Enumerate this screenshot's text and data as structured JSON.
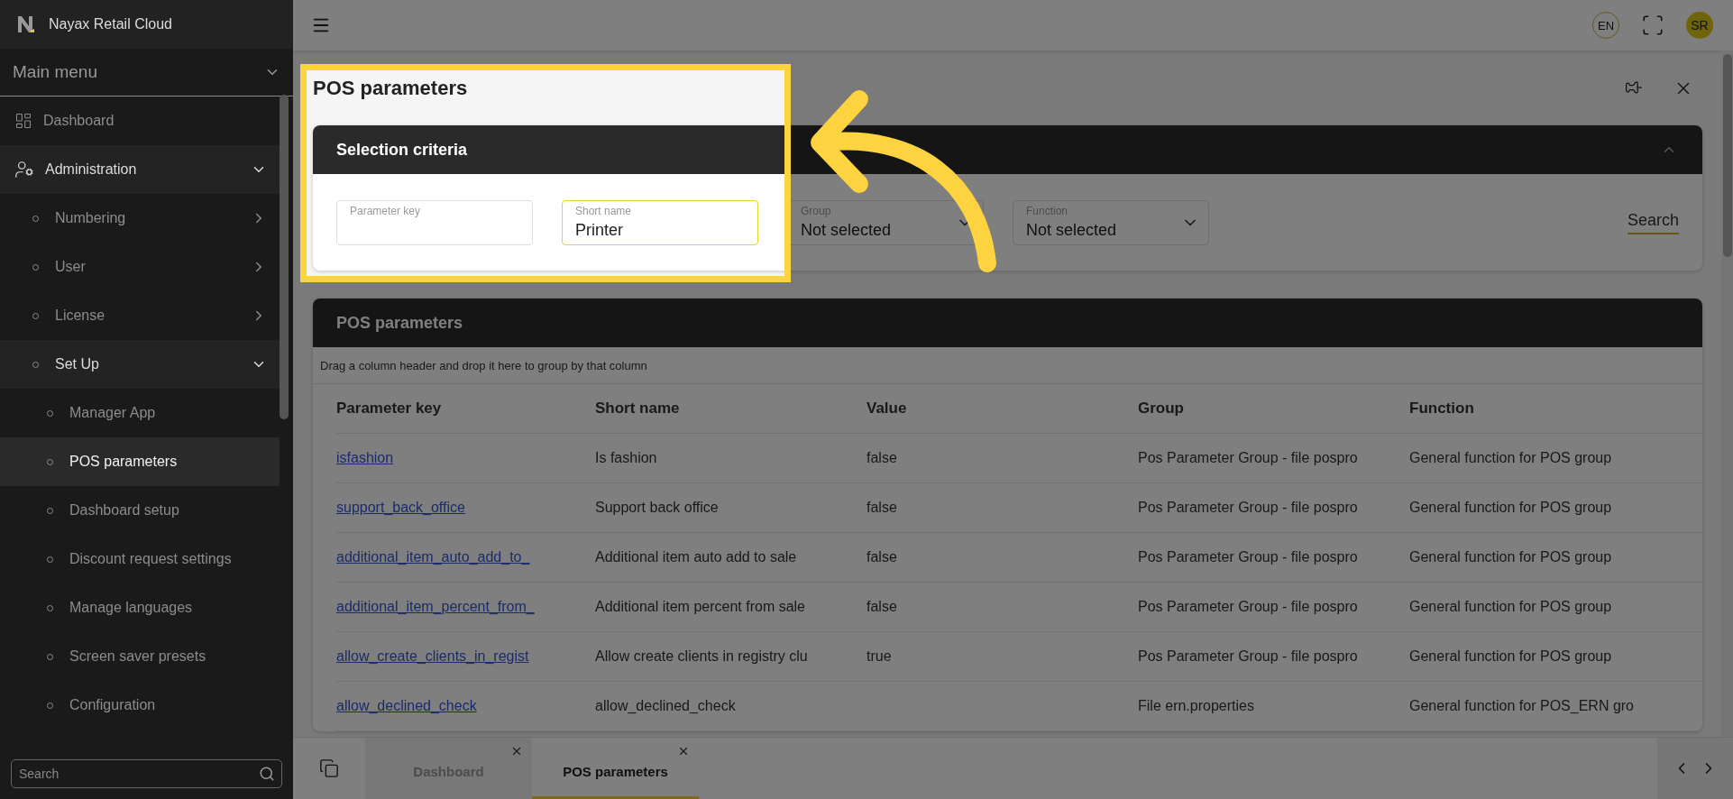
{
  "app": {
    "title": "Nayax Retail Cloud"
  },
  "sidebar": {
    "menu_title": "Main menu",
    "items": [
      {
        "label": "Dashboard",
        "selected": false
      },
      {
        "label": "Administration",
        "selected": false,
        "expanded": true,
        "children": [
          {
            "label": "Numbering",
            "selected": false,
            "expanded": false
          },
          {
            "label": "User",
            "selected": false,
            "expanded": false
          },
          {
            "label": "License",
            "selected": false,
            "expanded": false
          },
          {
            "label": "Set Up",
            "selected": false,
            "expanded": true,
            "children": [
              {
                "label": "Manager App",
                "selected": false
              },
              {
                "label": "POS parameters",
                "selected": true
              },
              {
                "label": "Dashboard setup",
                "selected": false
              },
              {
                "label": "Discount request settings",
                "selected": false
              },
              {
                "label": "Manage languages",
                "selected": false
              },
              {
                "label": "Screen saver presets",
                "selected": false
              },
              {
                "label": "Configuration",
                "selected": false
              }
            ]
          }
        ]
      }
    ],
    "search": {
      "placeholder": "Search"
    }
  },
  "topbar": {
    "language": "EN",
    "avatar": "SR"
  },
  "page": {
    "title": "POS parameters"
  },
  "criteria": {
    "title": "Selection criteria",
    "expanded": true,
    "fields": [
      {
        "kind": "text",
        "label": "Parameter key",
        "focused": false
      },
      {
        "kind": "text",
        "label": "Short name",
        "value": "Printer",
        "focused": true
      },
      {
        "kind": "select",
        "label": "Group",
        "value": "Not selected"
      },
      {
        "kind": "select",
        "label": "Function",
        "value": "Not selected"
      }
    ],
    "search_button": "Search"
  },
  "table": {
    "title": "POS parameters",
    "group_hint": "Drag a column header and drop it here to group by that column",
    "columns": [
      "Parameter key",
      "Short name",
      "Value",
      "Group",
      "Function"
    ],
    "rows": [
      {
        "key": "isfashion",
        "short_name": "Is fashion",
        "value": "false",
        "group": "Pos Parameter Group - file pospro",
        "function": "General function for POS group"
      },
      {
        "key": "support_back_office",
        "short_name": "Support back office",
        "value": "false",
        "group": "Pos Parameter Group - file pospro",
        "function": "General function for POS group"
      },
      {
        "key": "additional_item_auto_add_to_",
        "short_name": "Additional item auto add to sale",
        "value": "false",
        "group": "Pos Parameter Group - file pospro",
        "function": "General function for POS group"
      },
      {
        "key": "additional_item_percent_from_",
        "short_name": "Additional item percent from sale",
        "value": "false",
        "group": "Pos Parameter Group - file pospro",
        "function": "General function for POS group"
      },
      {
        "key": "allow_create_clients_in_regist",
        "short_name": "Allow create clients in registry clu",
        "value": "true",
        "group": "Pos Parameter Group - file pospro",
        "function": "General function for POS group"
      },
      {
        "key": "allow_declined_check",
        "short_name": "allow_declined_check",
        "group": "File ern.properties",
        "function": "General function for POS_ERN gro"
      }
    ]
  },
  "tabs": [
    {
      "label": "Dashboard",
      "selected": false
    },
    {
      "label": "POS parameters",
      "selected": true
    }
  ]
}
